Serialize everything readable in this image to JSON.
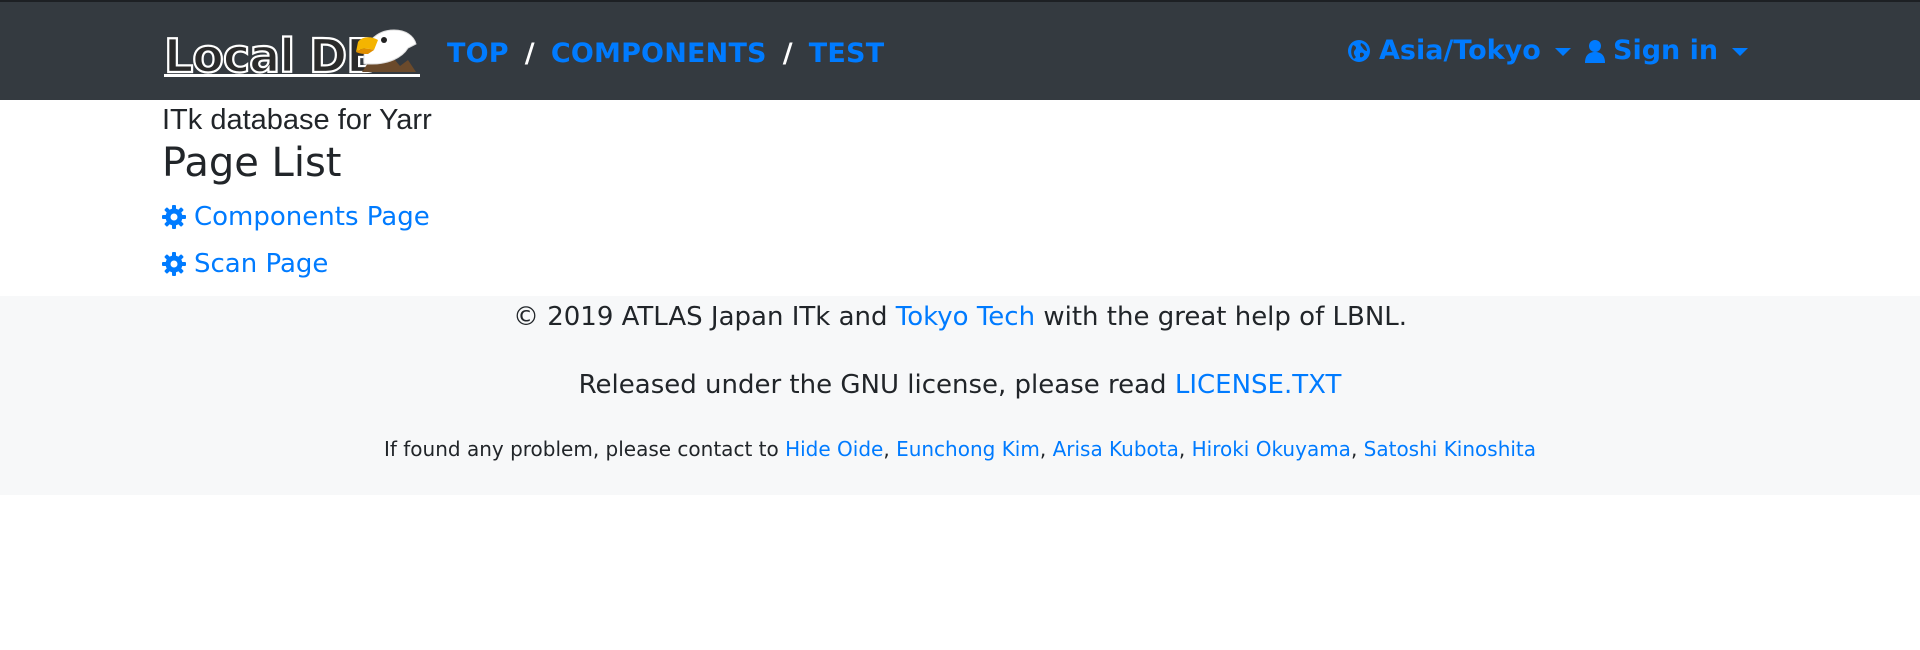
{
  "navbar": {
    "logo_text": "Local DB",
    "breadcrumb": [
      "TOP",
      "COMPONENTS",
      "TEST"
    ],
    "separator": "/",
    "timezone": "Asia/Tokyo",
    "signin": "Sign in"
  },
  "main": {
    "subtitle": "ITk database for Yarr",
    "title": "Page List",
    "links": [
      "Components Page",
      "Scan Page"
    ]
  },
  "footer": {
    "line1_prefix": "© 2019 ATLAS Japan ITk and ",
    "line1_link": "Tokyo Tech",
    "line1_suffix": " with the great help of LBNL.",
    "line2_prefix": "Released under the GNU license, please read ",
    "line2_link": "LICENSE.TXT",
    "line3_prefix": "If found any problem, please contact to ",
    "contacts": [
      "Hide Oide",
      "Eunchong Kim",
      "Arisa Kubota",
      "Hiroki Okuyama",
      "Satoshi Kinoshita"
    ],
    "contact_sep": ", "
  },
  "colors": {
    "navbar_bg": "#343a40",
    "link": "#007bff",
    "footer_bg": "#f7f8f9",
    "text": "#212529"
  }
}
